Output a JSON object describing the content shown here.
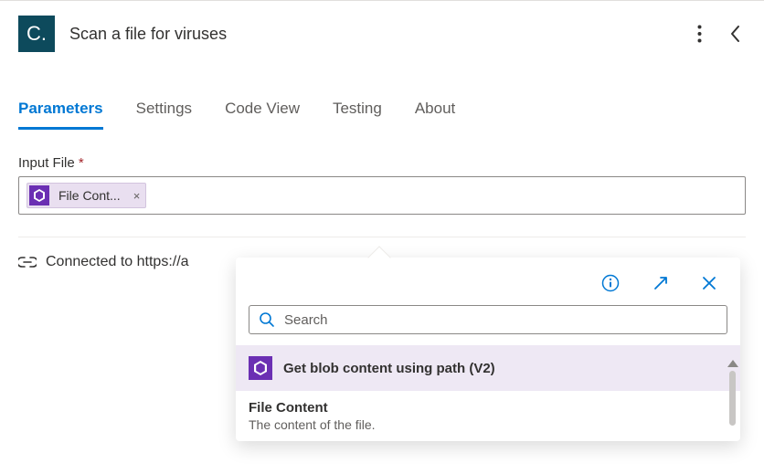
{
  "header": {
    "logo_text": "C.",
    "title": "Scan a file for viruses"
  },
  "tabs": [
    {
      "label": "Parameters",
      "active": true
    },
    {
      "label": "Settings",
      "active": false
    },
    {
      "label": "Code View",
      "active": false
    },
    {
      "label": "Testing",
      "active": false
    },
    {
      "label": "About",
      "active": false
    }
  ],
  "field": {
    "label": "Input File",
    "required_marker": "*",
    "token": {
      "text": "File Cont...",
      "remove": "×"
    }
  },
  "connection": {
    "text": "Connected to https://a"
  },
  "popup": {
    "search_placeholder": "Search",
    "group_title": "Get blob content using path (V2)",
    "item": {
      "title": "File Content",
      "desc": "The content of the file."
    }
  }
}
